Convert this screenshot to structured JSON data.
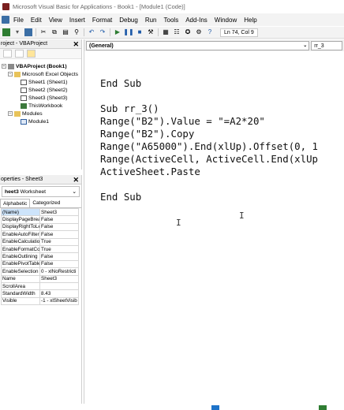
{
  "window": {
    "title": "Microsoft Visual Basic for Applications - Book1 - [Module1 (Code)]"
  },
  "menu": {
    "items": [
      "File",
      "Edit",
      "View",
      "Insert",
      "Format",
      "Debug",
      "Run",
      "Tools",
      "Add-Ins",
      "Window",
      "Help"
    ]
  },
  "toolbar": {
    "position_label": "Ln 74, Col 9"
  },
  "project_explorer": {
    "header": "roject - VBAProject",
    "tree": [
      {
        "label": "VBAProject (Book1)",
        "level": 0,
        "icon": "project-icon",
        "bold": true
      },
      {
        "label": "Microsoft Excel Objects",
        "level": 1,
        "icon": "folder-icon"
      },
      {
        "label": "Sheet1 (Sheet1)",
        "level": 2,
        "icon": "sheet-icon"
      },
      {
        "label": "Sheet2 (Sheet2)",
        "level": 2,
        "icon": "sheet-icon"
      },
      {
        "label": "Sheet3 (Sheet3)",
        "level": 2,
        "icon": "sheet-icon"
      },
      {
        "label": "ThisWorkbook",
        "level": 2,
        "icon": "workbook-icon"
      },
      {
        "label": "Modules",
        "level": 1,
        "icon": "folder-icon"
      },
      {
        "label": "Module1",
        "level": 2,
        "icon": "module-icon"
      }
    ]
  },
  "properties": {
    "header": "operties - Sheet3",
    "object_name": "heet3",
    "object_type": "Worksheet",
    "tabs": [
      "Alphabetic",
      "Categorized"
    ],
    "rows": [
      {
        "key": "(Name)",
        "value": "Sheet3"
      },
      {
        "key": "DisplayPageBreak",
        "value": "False"
      },
      {
        "key": "DisplayRightToLe",
        "value": "False"
      },
      {
        "key": "EnableAutoFilter",
        "value": "False"
      },
      {
        "key": "EnableCalculation",
        "value": "True"
      },
      {
        "key": "EnableFormatCor",
        "value": "True"
      },
      {
        "key": "EnableOutlining",
        "value": "False"
      },
      {
        "key": "EnablePivotTable",
        "value": "False"
      },
      {
        "key": "EnableSelection",
        "value": "0 - xlNoRestricti"
      },
      {
        "key": "Name",
        "value": "Sheet3"
      },
      {
        "key": "ScrollArea",
        "value": ""
      },
      {
        "key": "StandardWidth",
        "value": "8.43"
      },
      {
        "key": "Visible",
        "value": "-1 - xlSheetVisib"
      }
    ]
  },
  "code": {
    "object_combo": "(General)",
    "proc_combo": "rr_3",
    "lines": [
      "End Sub",
      "",
      "Sub rr_3()",
      "Range(\"B2\").Value = \"=A2*20\"",
      "Range(\"B2\").Copy",
      "Range(\"A65000\").End(xlUp).Offset(0, 1",
      "Range(ActiveCell, ActiveCell.End(xlUp",
      "ActiveSheet.Paste",
      "",
      "End Sub"
    ]
  }
}
